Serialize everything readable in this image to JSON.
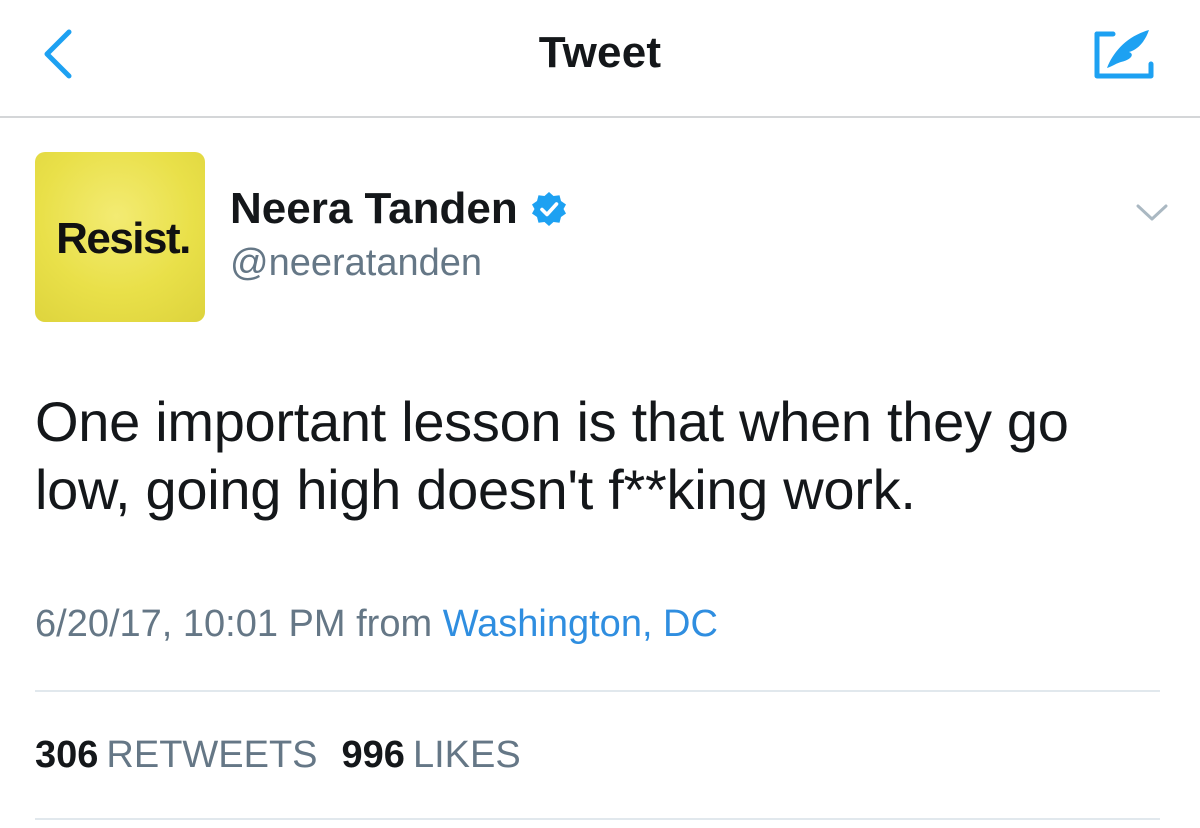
{
  "nav": {
    "title": "Tweet",
    "back_icon": "chevron-left-icon",
    "compose_icon": "compose-tweet-icon",
    "accent_color": "#1da1f2"
  },
  "author": {
    "avatar_text": "Resist.",
    "avatar_color": "#e9e049",
    "display_name": "Neera Tanden",
    "verified": true,
    "verified_icon": "verified-badge-icon",
    "handle": "@neeratanden",
    "menu_icon": "chevron-down-icon"
  },
  "tweet": {
    "text": "One important lesson is that when they go low, going high doesn't f**king work.",
    "timestamp": "6/20/17, 10:01 PM",
    "from_label": "from",
    "location": "Washington, DC",
    "link_color": "#2f8ee0"
  },
  "stats": {
    "retweets_count": "306",
    "retweets_label": "RETWEETS",
    "likes_count": "996",
    "likes_label": "LIKES"
  }
}
